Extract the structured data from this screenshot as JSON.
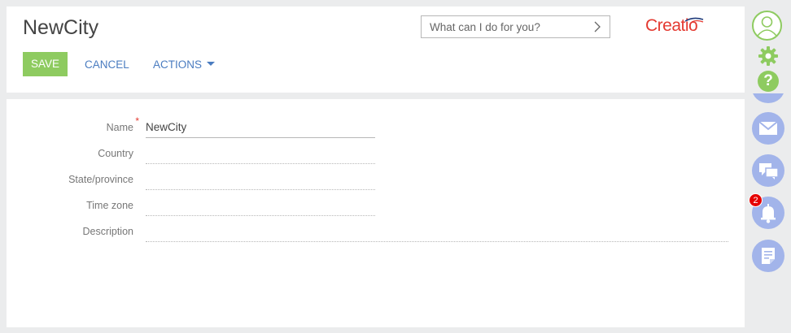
{
  "page": {
    "title": "NewCity"
  },
  "search": {
    "placeholder": "What can I do for you?"
  },
  "logo": {
    "text": "Creatio"
  },
  "toolbar": {
    "save_label": "SAVE",
    "cancel_label": "CANCEL",
    "actions_label": "ACTIONS"
  },
  "form": {
    "fields": [
      {
        "label": "Name",
        "value": "NewCity",
        "required": true
      },
      {
        "label": "Country",
        "value": ""
      },
      {
        "label": "State/province",
        "value": ""
      },
      {
        "label": "Time zone",
        "value": ""
      },
      {
        "label": "Description",
        "value": ""
      }
    ]
  },
  "right_bar": {
    "icons": [
      "user-avatar-icon",
      "gear-icon",
      "help-icon",
      "email-icon",
      "chat-icon",
      "bell-icon",
      "document-icon"
    ],
    "notification_count": "2"
  },
  "colors": {
    "accent_green": "#8ecb60",
    "link_blue": "#4a7cc0",
    "logo_red": "#e43a31",
    "panel_blue": "#a2b4ea",
    "badge_red": "#e60000"
  }
}
